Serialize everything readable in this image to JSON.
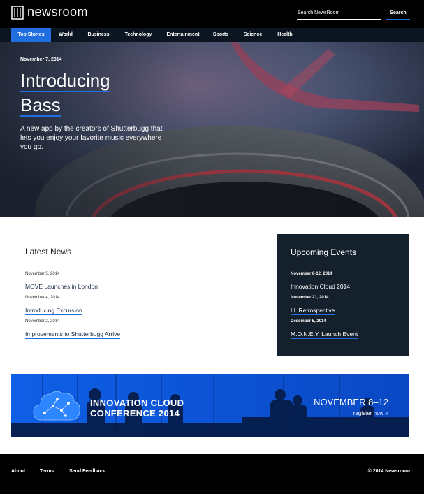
{
  "header": {
    "logo_text": "newsroom",
    "search_placeholder": "Search NewsRoom",
    "search_button": "Search"
  },
  "nav": {
    "items": [
      {
        "label": "Top Stories",
        "active": true
      },
      {
        "label": "World"
      },
      {
        "label": "Business"
      },
      {
        "label": "Technology"
      },
      {
        "label": "Entertainment"
      },
      {
        "label": "Sports"
      },
      {
        "label": "Science"
      },
      {
        "label": "Health"
      }
    ]
  },
  "hero": {
    "date": "November 7, 2014",
    "title_line1": "Introducing",
    "title_line2": "Bass",
    "description": "A new app by the creators of Shutterbugg that lets you enjoy your favorite music everywhere you go."
  },
  "latest": {
    "title": "Latest News",
    "items": [
      {
        "date": "November 5, 2014",
        "title": "MOVE Launches in London"
      },
      {
        "date": "November 4, 2014",
        "title": "Introducing Excursion"
      },
      {
        "date": "November 2, 2014",
        "title": "Improvements to Shutterbugg Arrive"
      }
    ]
  },
  "events": {
    "title": "Upcoming Events",
    "items": [
      {
        "date": "November 8-12, 2014",
        "title": "Innovation Cloud 2014"
      },
      {
        "date": "November 21, 2014",
        "title": "LL Retrospective"
      },
      {
        "date": "December 5, 2014",
        "title": "M.O.N.E.Y. Launch Event"
      }
    ]
  },
  "banner": {
    "title_line1": "INNOVATION CLOUD",
    "title_line2": "CONFERENCE 2014",
    "date": "NOVEMBER 8–12",
    "link": "register now »",
    "icon": "cloud-network-icon"
  },
  "footer": {
    "links": [
      "About",
      "Terms",
      "Send Feedback"
    ],
    "copyright": "© 2014 Newsroom"
  },
  "colors": {
    "accent": "#1f6fe0",
    "header_bg": "#000000",
    "nav_bg": "#0b1521",
    "events_bg": "#15202d",
    "banner_bg": "#0d55d6"
  }
}
